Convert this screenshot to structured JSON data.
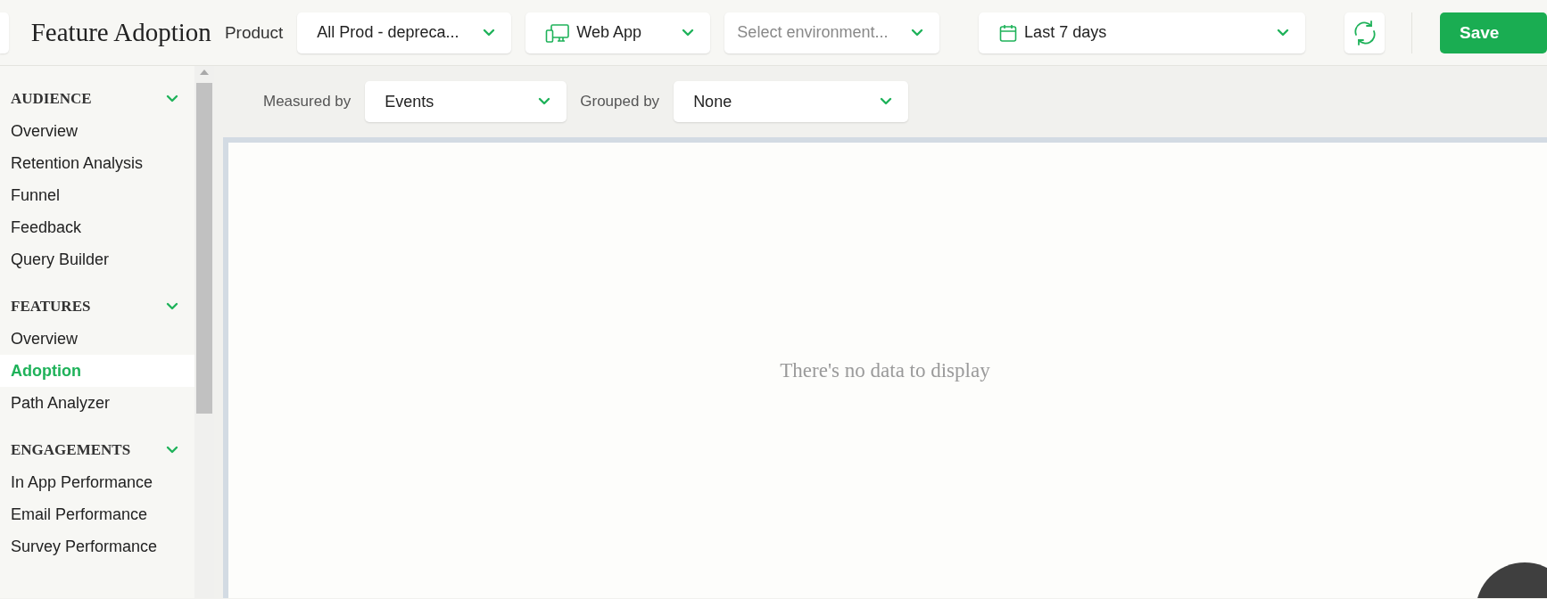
{
  "header": {
    "title": "Feature Adoption",
    "product_label": "Product",
    "product_select": {
      "value": "All Prod - depreca..."
    },
    "platform_select": {
      "value": "Web App"
    },
    "environment_select": {
      "placeholder": "Select environment..."
    },
    "date_select": {
      "value": "Last 7 days"
    },
    "save_button": "Save"
  },
  "sidebar": {
    "sections": [
      {
        "title": "AUDIENCE",
        "expanded": true,
        "items": [
          {
            "label": "Overview",
            "selected": false
          },
          {
            "label": "Retention Analysis",
            "selected": false
          },
          {
            "label": "Funnel",
            "selected": false
          },
          {
            "label": "Feedback",
            "selected": false
          },
          {
            "label": "Query Builder",
            "selected": false
          }
        ]
      },
      {
        "title": "FEATURES",
        "expanded": true,
        "items": [
          {
            "label": "Overview",
            "selected": false
          },
          {
            "label": "Adoption",
            "selected": true
          },
          {
            "label": "Path Analyzer",
            "selected": false
          }
        ]
      },
      {
        "title": "ENGAGEMENTS",
        "expanded": true,
        "items": [
          {
            "label": "In App Performance",
            "selected": false
          },
          {
            "label": "Email Performance",
            "selected": false
          },
          {
            "label": "Survey Performance",
            "selected": false
          }
        ]
      }
    ]
  },
  "filters": [
    {
      "label": "Measured by",
      "value": "Events"
    },
    {
      "label": "Grouped by",
      "value": "None"
    }
  ],
  "chart_panel": {
    "empty_message": "There's no data to display"
  }
}
